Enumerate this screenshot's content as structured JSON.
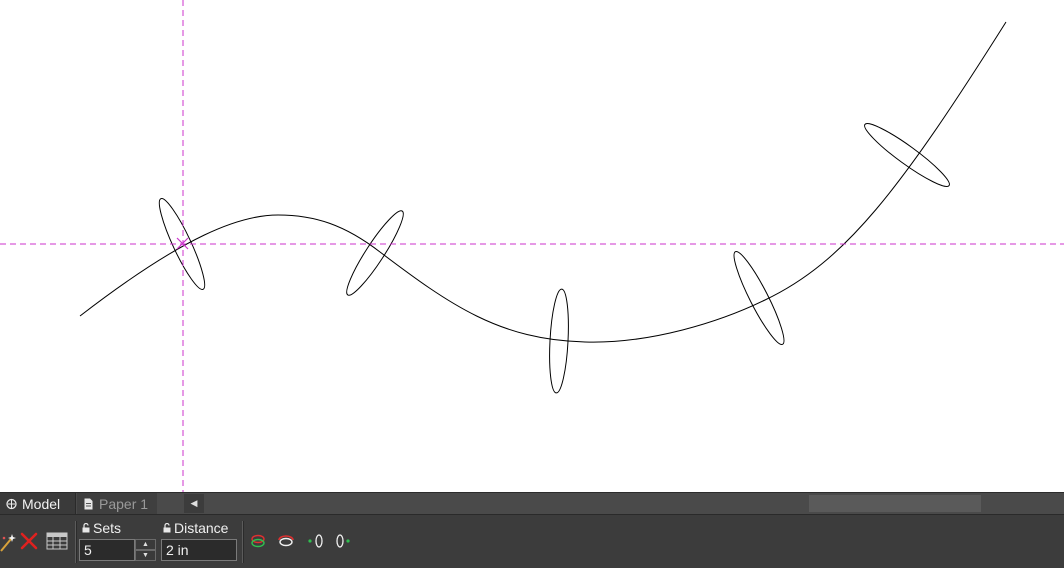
{
  "tabs": [
    {
      "label": "Model",
      "active": true
    },
    {
      "label": "Paper 1",
      "active": false
    }
  ],
  "toolbar": {
    "sets": {
      "label": "Sets",
      "value": "5"
    },
    "distance": {
      "label": "Distance",
      "value": "2 in"
    }
  },
  "icons": {
    "pick": "wand-pick-icon",
    "cancel": "close-x-icon",
    "table": "table-grid-icon",
    "mode1": "ellipse-red-green-icon",
    "mode2": "ellipse-arc-icon",
    "mode3": "ellipse-dot-left-icon",
    "mode4": "ellipse-dot-right-icon"
  },
  "colors": {
    "crosshair": "#cc33cc",
    "curve": "#000000",
    "panel": "#3c3c3c",
    "tabbar": "#4a4a4a",
    "cancel_red": "#e0211f"
  }
}
